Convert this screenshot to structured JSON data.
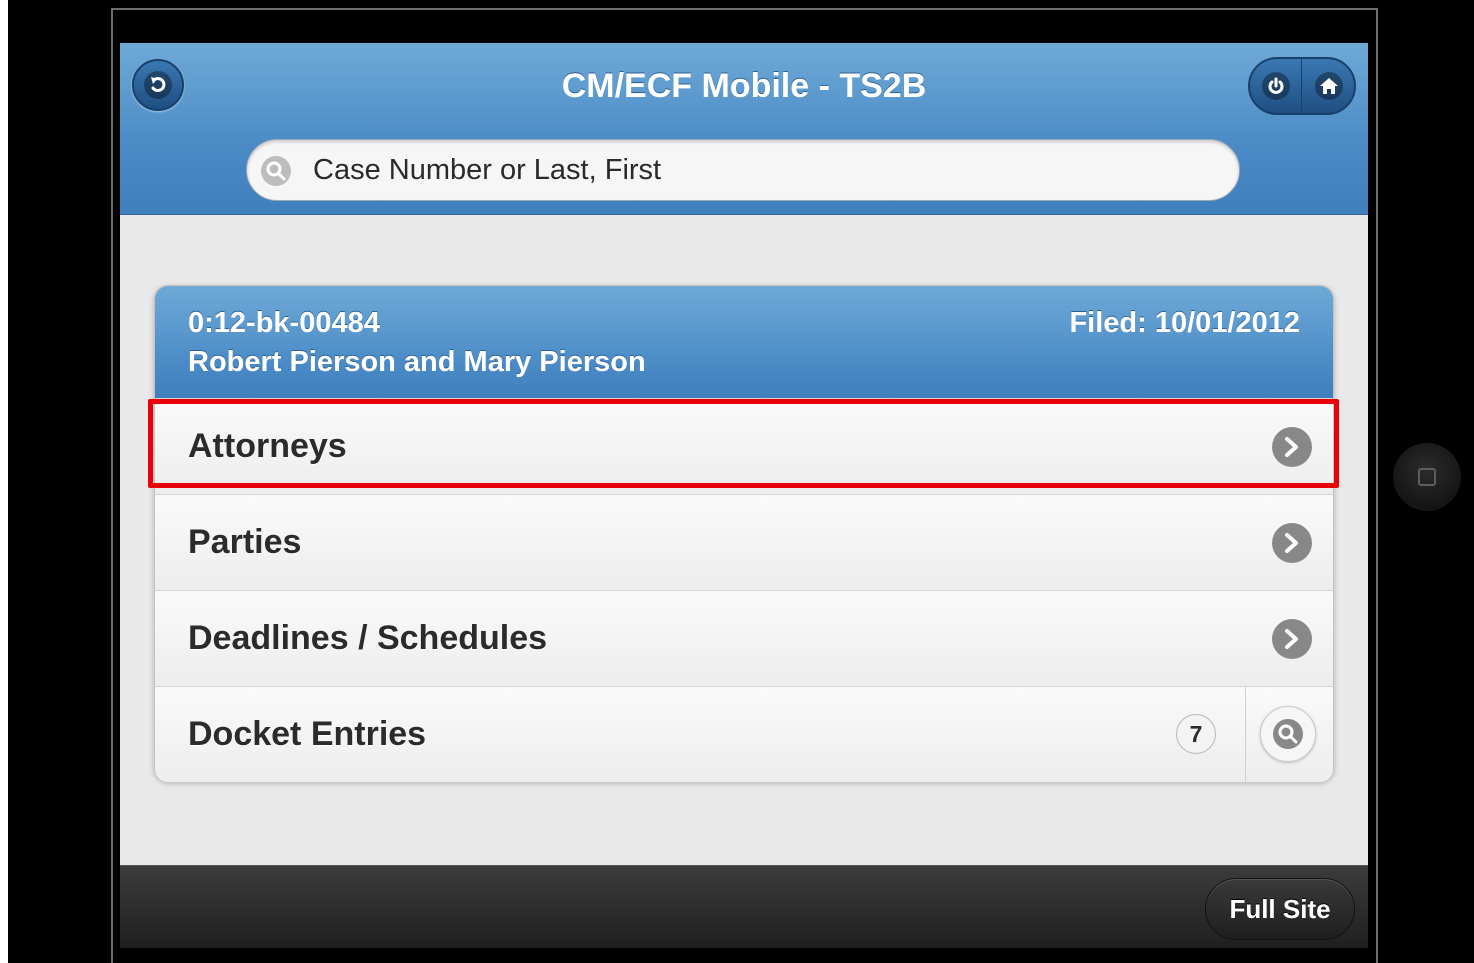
{
  "header": {
    "title": "CM/ECF Mobile - TS2B",
    "back_icon": "back-icon",
    "power_icon": "power-icon",
    "home_icon": "home-icon"
  },
  "search": {
    "placeholder": "Case Number or Last, First",
    "icon": "search-icon"
  },
  "case": {
    "number": "0:12-bk-00484",
    "filed": "Filed: 10/01/2012",
    "name": "Robert Pierson and Mary Pierson"
  },
  "menu": {
    "items": [
      {
        "label": "Attorneys"
      },
      {
        "label": "Parties"
      },
      {
        "label": "Deadlines / Schedules"
      },
      {
        "label": "Docket Entries",
        "count": "7"
      }
    ]
  },
  "footer": {
    "full_site_label": "Full Site"
  },
  "colors": {
    "header_blue": "#4a8bc6",
    "highlight_red": "#e8000b",
    "footer_dark": "#2a2a2a"
  }
}
